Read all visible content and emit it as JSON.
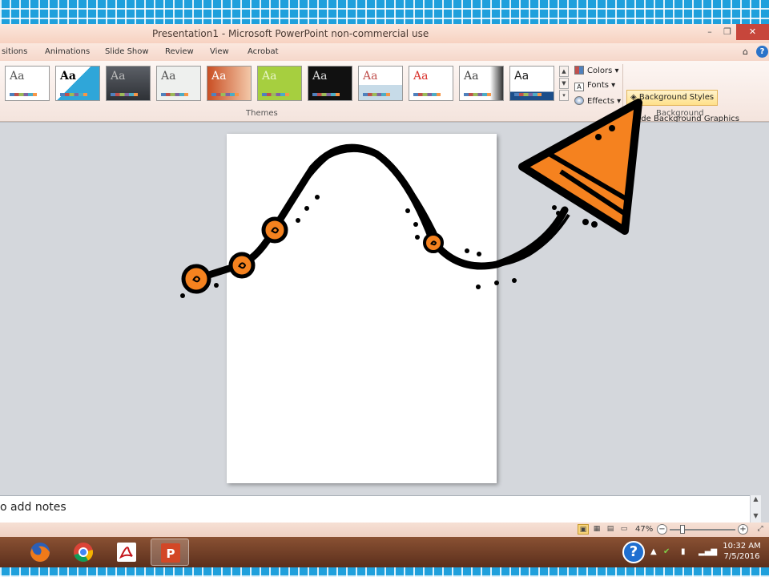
{
  "window": {
    "title": "Presentation1  -  Microsoft PowerPoint non-commercial use",
    "min_glyph": "–",
    "max_glyph": "❐",
    "close_glyph": "✕"
  },
  "tabs": [
    {
      "label": "sitions"
    },
    {
      "label": "Animations"
    },
    {
      "label": "Slide Show"
    },
    {
      "label": "Review"
    },
    {
      "label": "View"
    },
    {
      "label": "Acrobat"
    }
  ],
  "ribbon_extras": {
    "collapse_glyph": "⌂",
    "help_glyph": "?"
  },
  "themes": {
    "group_label": "Themes",
    "thumb_text": "Aa",
    "scroll_up": "▲",
    "scroll_down": "▼",
    "scroll_more": "▾"
  },
  "theme_options": {
    "colors": "Colors",
    "fonts": "Fonts",
    "effects": "Effects"
  },
  "background": {
    "group_label": "Background",
    "styles_button": "Background Styles",
    "hide_graphics": "Hide Background Graphics"
  },
  "notes": {
    "placeholder": "o add notes",
    "scroll_up": "▲",
    "scroll_down": "▼"
  },
  "status": {
    "zoom": "47%",
    "zoom_minus": "−",
    "zoom_plus": "+"
  },
  "taskbar": {
    "time": "10:32 AM",
    "date": "7/5/2016",
    "help_glyph": "?",
    "tray_arrow": "▲"
  },
  "colors": {
    "frame_blue": "#1fa0dc",
    "arrow_orange": "#f5821f",
    "close_red": "#c7463b",
    "taskbar_brown": "#6e3a22"
  }
}
